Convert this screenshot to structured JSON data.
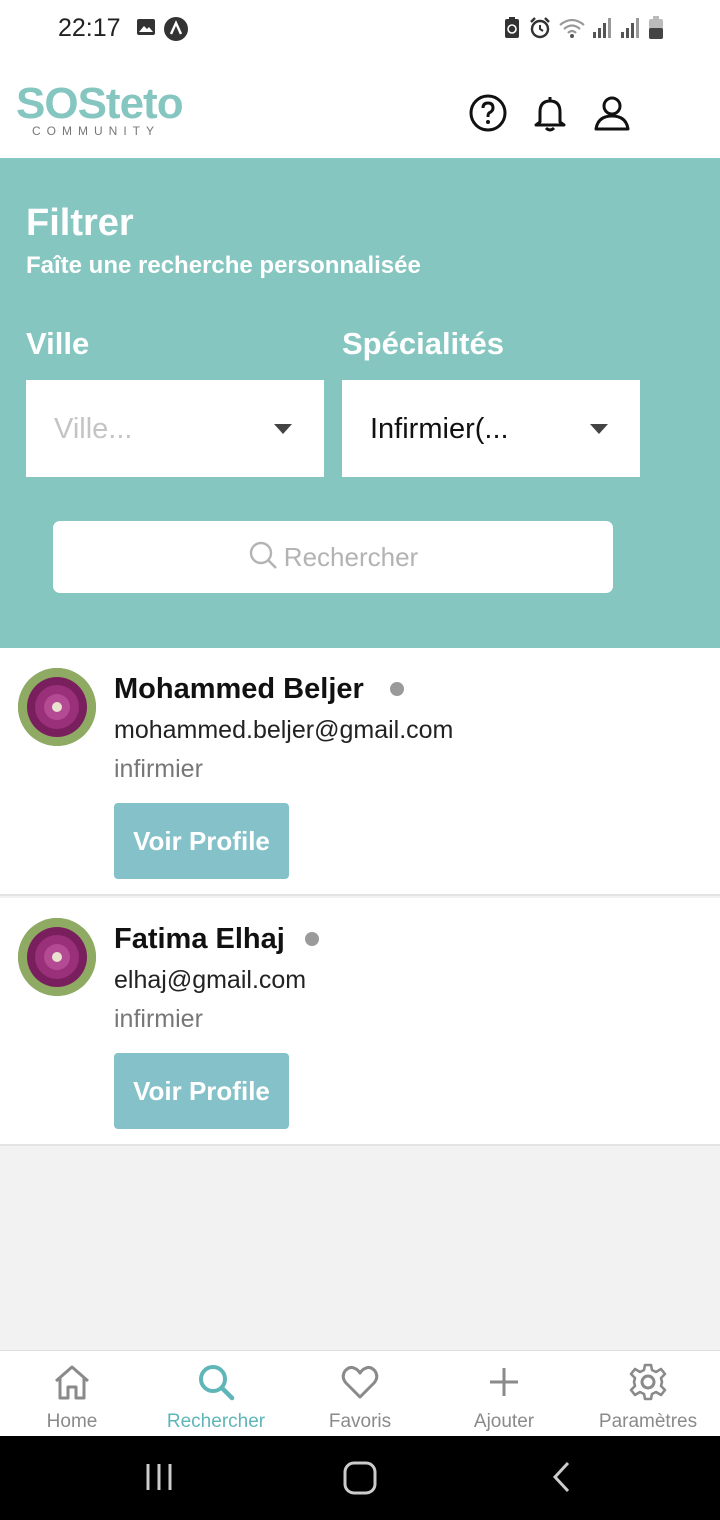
{
  "status": {
    "time": "22:17"
  },
  "brand": {
    "name": "SOSteto",
    "tagline": "COMMUNITY",
    "color": "#86c6c0"
  },
  "header_icons": [
    "help-icon",
    "bell-icon",
    "user-icon"
  ],
  "filter": {
    "title": "Filtrer",
    "subtitle": "Faîte une recherche personnalisée",
    "city_label": "Ville",
    "city_placeholder": "Ville...",
    "specialty_label": "Spécialités",
    "specialty_value": "Infirmier(...",
    "search_label": "Rechercher",
    "background": "#86c6c0"
  },
  "results": [
    {
      "name": "Mohammed Beljer",
      "email": "mohammed.beljer@gmail.com",
      "role": "infirmier",
      "action": "Voir Profile"
    },
    {
      "name": "Fatima Elhaj",
      "email": "elhaj@gmail.com",
      "role": "infirmier",
      "action": "Voir Profile"
    }
  ],
  "tabs": [
    {
      "label": "Home",
      "icon": "home-icon",
      "active": false
    },
    {
      "label": "Rechercher",
      "icon": "search-icon",
      "active": true
    },
    {
      "label": "Favoris",
      "icon": "heart-icon",
      "active": false
    },
    {
      "label": "Ajouter",
      "icon": "plus-icon",
      "active": false
    },
    {
      "label": "Paramètres",
      "icon": "gear-icon",
      "active": false
    }
  ]
}
